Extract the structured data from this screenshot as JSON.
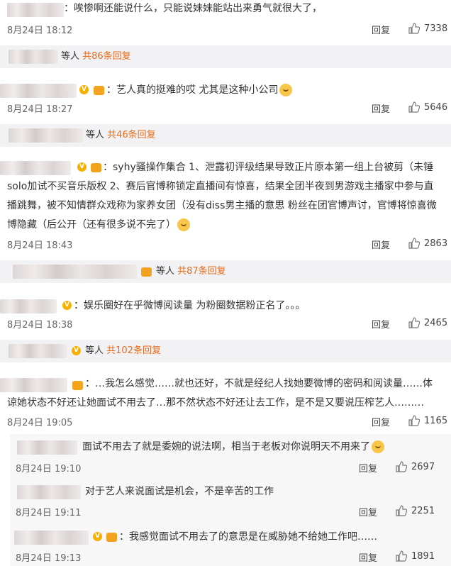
{
  "comments": [
    {
      "text": "：唉惨啊还能说什么，只能说妹妹能站出来勇气就很大了，",
      "date": "8月24日 18:12",
      "reply": "回复",
      "likes": "7338"
    },
    {
      "text": "：艺人真的挺难的哎 尤其是这种小公司",
      "date": "8月24日 18:27",
      "reply": "回复",
      "likes": "5646"
    },
    {
      "line1": "：syhy骚操作集合 1、泄露初评级结果导致正片原本第一组上台被剪（未锤",
      "line2": "solo加试不买音乐版权 2、赛后官博称锁定直播间有惊喜，结果全团半夜到男游戏主播家中参与直",
      "line3": "播跳舞，被不知情群众戏称为家养女团（没有diss男主播的意思 粉丝在团官博声讨，官博将惊喜微",
      "line4": "博隐藏（后公开（还有很多说不完了）",
      "date": "8月24日 18:43",
      "reply": "回复",
      "likes": "2863"
    },
    {
      "text": "：娱乐圈好在乎微博阅读量 为粉圈数据粉正名了。。。",
      "date": "8月24日 18:38",
      "reply": "回复",
      "likes": "2465"
    },
    {
      "line1": "：…我怎么感觉……就也还好，不就是经纪人找她要微博的密码和阅读量……体",
      "line2": "谅她状态不好还让她面试不用去了…那不然状态不好还让去工作，是不是又要说压榨艺人………",
      "date": "8月24日 19:05",
      "reply": "回复",
      "likes": "1165"
    }
  ],
  "subs": [
    {
      "prefix": "等人 ",
      "count": "共86条回复"
    },
    {
      "prefix": "等人 ",
      "count": "共46条回复"
    },
    {
      "prefix": "等人 ",
      "count": "共87条回复"
    },
    {
      "prefix": "等人 ",
      "count": "共102条回复"
    }
  ],
  "nested": [
    {
      "text": "面试不用去了就是委婉的说法啊，相当于老板对你说明天不用来了",
      "date": "8月24日 19:10",
      "reply": "回复",
      "likes": "2697"
    },
    {
      "text": "对于艺人来说面试是机会，不是辛苦的工作",
      "date": "8月24日 19:11",
      "reply": "回复",
      "likes": "2251"
    },
    {
      "text": "：我感觉面试不用去了的意思是在威胁她不给她工作吧……",
      "date": "8月24日 19:13",
      "reply": "回复",
      "likes": "1891"
    }
  ],
  "colors": {
    "accent": "#e86b19",
    "subbar": "#f2f2f5",
    "nested": "#f7f7f7"
  },
  "icons": {
    "like": "thumbs-up-icon",
    "vip": "v-badge-icon",
    "crown": "crown-icon"
  }
}
